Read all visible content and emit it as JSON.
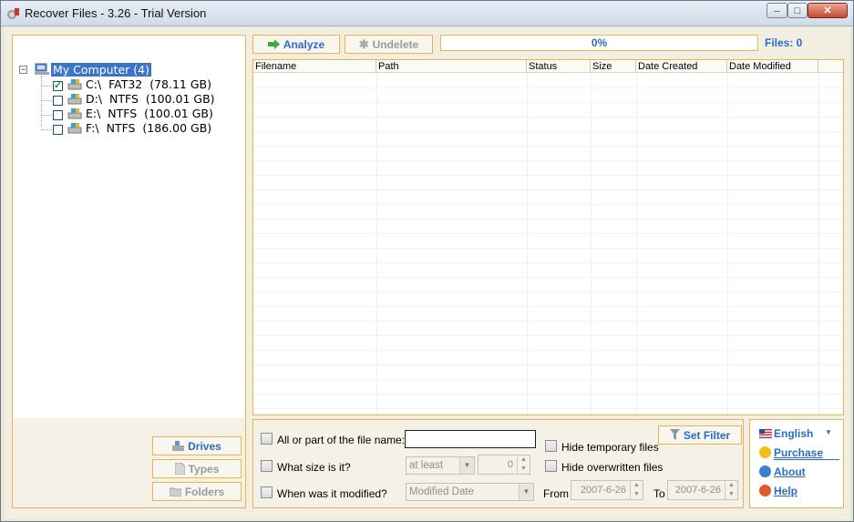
{
  "window": {
    "title": "Recover Files - 3.26 - Trial Version",
    "min_glyph": "─",
    "max_glyph": "□",
    "close_glyph": "✕"
  },
  "tree": {
    "expander": "−",
    "root": "My Computer (4)",
    "drives": [
      {
        "label": "C:\\  FAT32  (78.11 GB)",
        "checked": true
      },
      {
        "label": "D:\\  NTFS  (100.01 GB)",
        "checked": false
      },
      {
        "label": "E:\\  NTFS  (100.01 GB)",
        "checked": false
      },
      {
        "label": "F:\\  NTFS  (186.00 GB)",
        "checked": false
      }
    ]
  },
  "side_buttons": {
    "drives": "Drives",
    "types": "Types",
    "folders": "Folders"
  },
  "toolbar": {
    "analyze": "Analyze",
    "undelete": "Undelete",
    "progress": "0%",
    "progress_value": 0,
    "files": "Files: 0"
  },
  "grid": {
    "columns": [
      "Filename",
      "Path",
      "Status",
      "Size",
      "Date Created",
      "Date Modified"
    ]
  },
  "filter": {
    "name_label": "All or part of the file name:",
    "name_value": "",
    "size_label": "What size is it?",
    "size_mode": "at least",
    "size_value": "0",
    "modified_label": "When was it modified?",
    "modified_mode": "Modified Date",
    "from_label": "From",
    "from_value": "2007-6-26",
    "to_label": "To",
    "to_value": "2007-6-26",
    "hide_temp": "Hide temporary files",
    "hide_overwritten": "Hide overwritten files",
    "set_filter": "Set Filter"
  },
  "info": {
    "language": "English",
    "purchase": "Purchase",
    "about": "About",
    "help": "Help"
  },
  "colors": {
    "accent": "#2a6ccf",
    "border": "#f0b34e",
    "selection": "#3b73c9"
  }
}
